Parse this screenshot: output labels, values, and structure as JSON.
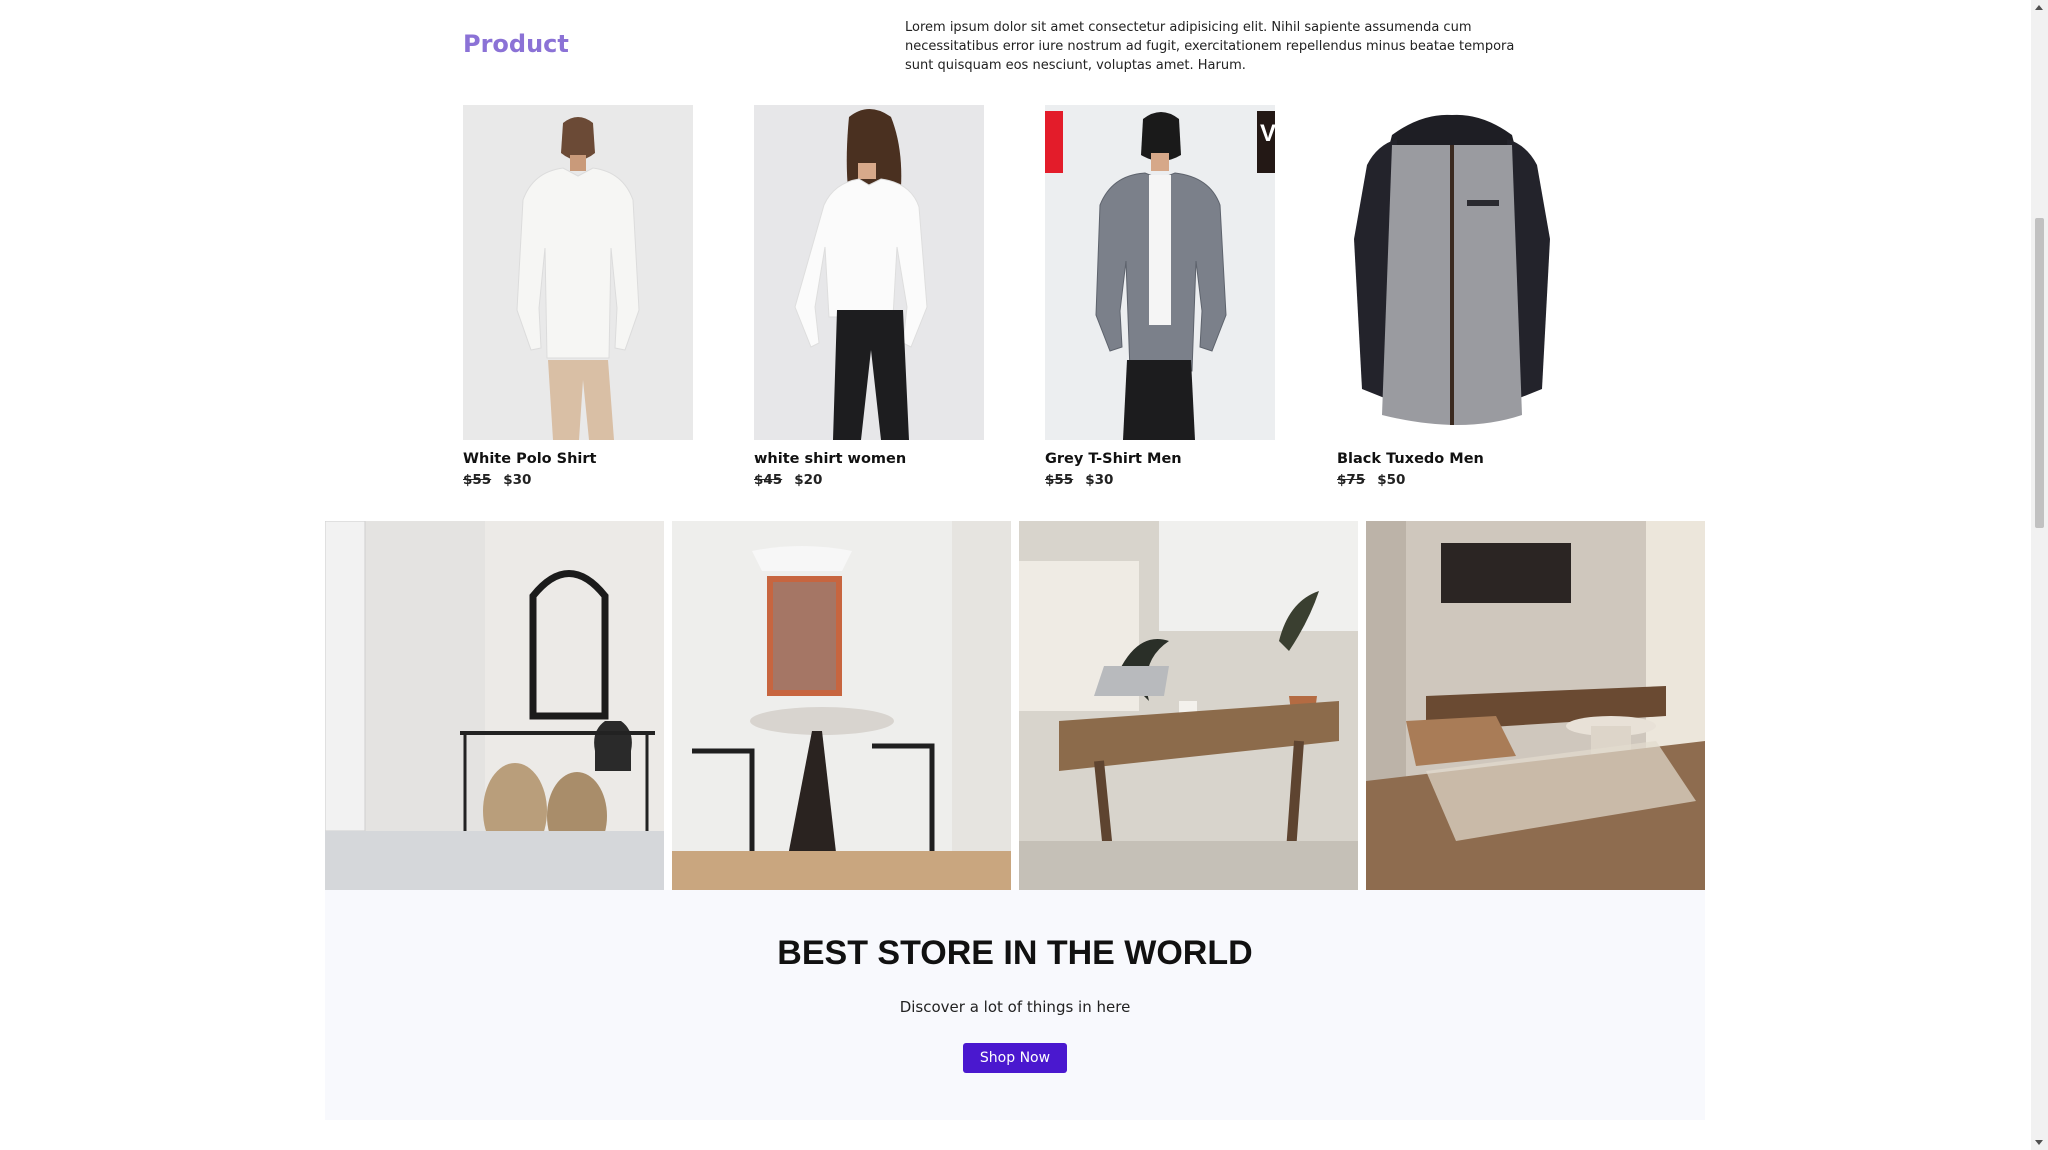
{
  "section": {
    "title": "Product",
    "description": "Lorem ipsum dolor sit amet consectetur adipisicing elit. Nihil sapiente assumenda cum necessitatibus error iure nostrum ad fugit, exercitationem repellendus minus beatae tempora sunt quisquam eos nesciunt, voluptas amet. Harum."
  },
  "products": [
    {
      "name": "White Polo Shirt",
      "old_price": "$55",
      "price": "$30"
    },
    {
      "name": "white shirt women",
      "old_price": "$45",
      "price": "$20"
    },
    {
      "name": "Grey T-Shirt Men",
      "old_price": "$55",
      "price": "$30"
    },
    {
      "name": "Black Tuxedo Men",
      "old_price": "$75",
      "price": "$50"
    }
  ],
  "store": {
    "heading": "BEST STORE IN THE WORLD",
    "subtext": "Discover a lot of things in here",
    "button_label": "Shop Now"
  },
  "colors": {
    "accent": "#8b72d6",
    "button": "#4a18cf"
  }
}
